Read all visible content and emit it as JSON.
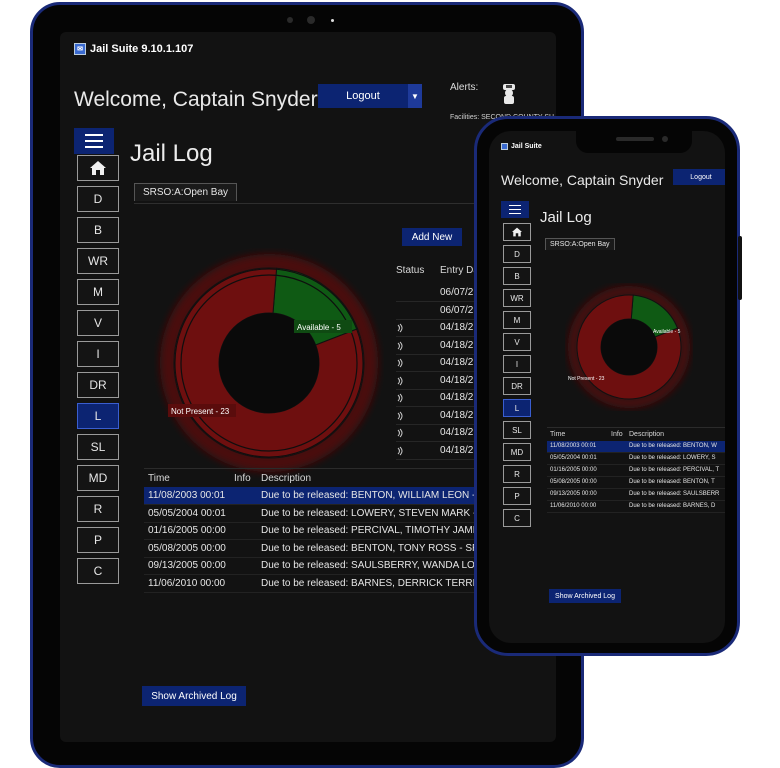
{
  "app": {
    "title": "Jail Suite 9.10.1.107"
  },
  "header": {
    "welcome": "Welcome, Captain Snyder",
    "logout_label": "Logout",
    "alerts_label": "Alerts:",
    "facilities": "Facilities: SECOND COUNTY SH"
  },
  "sidebar": {
    "items": [
      {
        "label": "",
        "icon": "home-icon"
      },
      {
        "label": "D"
      },
      {
        "label": "B"
      },
      {
        "label": "WR"
      },
      {
        "label": "M"
      },
      {
        "label": "V"
      },
      {
        "label": "I"
      },
      {
        "label": "DR"
      },
      {
        "label": "L",
        "active": true
      },
      {
        "label": "SL"
      },
      {
        "label": "MD"
      },
      {
        "label": "R"
      },
      {
        "label": "P"
      },
      {
        "label": "C"
      }
    ]
  },
  "page": {
    "title": "Jail Log",
    "tab": "SRSO:A:Open Bay",
    "add_new": "Add New",
    "show_archived": "Show Archived Log"
  },
  "donut": {
    "available_label": "Available - 5",
    "not_present_label": "Not Present - 23",
    "available": 5,
    "not_present": 23,
    "colors": {
      "available": "#0f5a14",
      "not_present": "#6e0f0f"
    }
  },
  "status_table": {
    "headers": {
      "status": "Status",
      "entry_date": "Entry Da"
    },
    "rows": [
      {
        "icon": false,
        "date": "06/07/2"
      },
      {
        "icon": false,
        "date": "06/07/2"
      },
      {
        "icon": true,
        "date": "04/18/2"
      },
      {
        "icon": true,
        "date": "04/18/2"
      },
      {
        "icon": true,
        "date": "04/18/2"
      },
      {
        "icon": true,
        "date": "04/18/2"
      },
      {
        "icon": true,
        "date": "04/18/2"
      },
      {
        "icon": true,
        "date": "04/18/2"
      },
      {
        "icon": true,
        "date": "04/18/2"
      },
      {
        "icon": true,
        "date": "04/18/2"
      }
    ]
  },
  "log": {
    "headers": {
      "time": "Time",
      "info": "Info",
      "description": "Description"
    },
    "rows": [
      {
        "time": "11/08/2003 00:01",
        "description": "Due to be released: BENTON, WILLIAM LEON - S",
        "selected": true
      },
      {
        "time": "05/05/2004 00:01",
        "description": "Due to be released: LOWERY, STEVEN MARK - SR"
      },
      {
        "time": "01/16/2005 00:00",
        "description": "Due to be released: PERCIVAL, TIMOTHY JAMES I"
      },
      {
        "time": "05/08/2005 00:00",
        "description": "Due to be released: BENTON, TONY ROSS - SRSO"
      },
      {
        "time": "09/13/2005 00:00",
        "description": "Due to be released: SAULSBERRY, WANDA LORRA"
      },
      {
        "time": "11/06/2010 00:00",
        "description": "Due to be released: BARNES, DERRICK TERRELL -"
      }
    ]
  },
  "phone": {
    "app_title": "Jail Suite",
    "welcome": "Welcome, Captain Snyder",
    "logout_label": "Logout",
    "page_title": "Jail Log",
    "tab": "SRSO:A:Open Bay",
    "available_label": "Available - 5",
    "not_present_label": "Not Present - 23",
    "show_archived": "Show Archived Log",
    "sidebar": [
      {
        "label": "",
        "icon": "home-icon"
      },
      {
        "label": "D"
      },
      {
        "label": "B"
      },
      {
        "label": "WR"
      },
      {
        "label": "M"
      },
      {
        "label": "V"
      },
      {
        "label": "I"
      },
      {
        "label": "DR"
      },
      {
        "label": "L",
        "active": true
      },
      {
        "label": "SL"
      },
      {
        "label": "MD"
      },
      {
        "label": "R"
      },
      {
        "label": "P"
      },
      {
        "label": "C"
      }
    ],
    "log_rows": [
      {
        "time": "11/08/2003 00:01",
        "description": "Due to be released: BENTON, W",
        "selected": true
      },
      {
        "time": "05/05/2004 00:01",
        "description": "Due to be released: LOWERY, S"
      },
      {
        "time": "01/16/2005 00:00",
        "description": "Due to be released: PERCIVAL, T"
      },
      {
        "time": "05/08/2005 00:00",
        "description": "Due to be released: BENTON, T"
      },
      {
        "time": "09/13/2005 00:00",
        "description": "Due to be released: SAULSBERR"
      },
      {
        "time": "11/06/2010 00:00",
        "description": "Due to be released: BARNES, D"
      }
    ]
  }
}
